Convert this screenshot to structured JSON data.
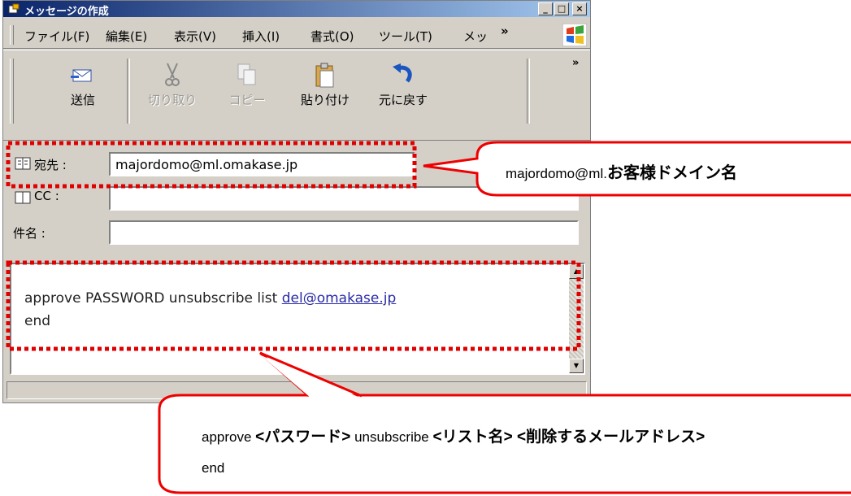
{
  "window": {
    "title": "メッセージの作成",
    "controls": [
      "_",
      "□",
      "×"
    ]
  },
  "menu": {
    "items": [
      {
        "label": "ファイル(F)"
      },
      {
        "label": "編集(E)"
      },
      {
        "label": "表示(V)"
      },
      {
        "label": "挿入(I)"
      },
      {
        "label": "書式(O)"
      },
      {
        "label": "ツール(T)"
      },
      {
        "label": "メッ"
      }
    ],
    "overflow": "»"
  },
  "toolbar": {
    "send": "送信",
    "cut": "切り取り",
    "copy": "コピー",
    "paste": "貼り付け",
    "undo": "元に戻す",
    "overflow": "»"
  },
  "header": {
    "to_label": "宛先 :",
    "to_value": "majordomo@ml.omakase.jp",
    "cc_label": "CC :",
    "cc_value": "",
    "subject_label": "件名 :",
    "subject_value": ""
  },
  "body": {
    "line1": "approve PASSWORD unsubscribe list ",
    "link": "del@omakase.jp",
    "line2": "end"
  },
  "annotations": {
    "to_note_plain": "majordomo@ml.",
    "to_note_bold": "お客様ドメイン名",
    "body_note": {
      "approve": "approve ",
      "password": "<パスワード>",
      "unsubscribe": " unsubscribe ",
      "list": "<リスト名>",
      "address": " <削除するメールアドレス>",
      "end": "end"
    },
    "colors": {
      "callout": "#ee0000",
      "highlight_box": "#e00000"
    }
  }
}
